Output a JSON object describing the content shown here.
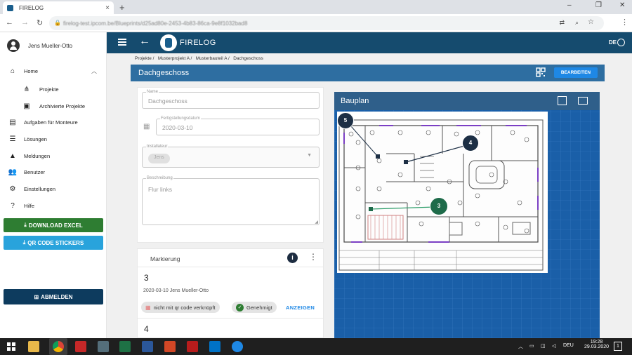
{
  "browser": {
    "tab_title": "FIRELOG",
    "tab_close": "×",
    "new_tab": "+",
    "url": "firelog-test.ipcom.be/Blueprints/d25ad80e-2453-4b83-86ca-9e8f1032bad8",
    "controls": {
      "minimize": "–",
      "maximize": "❐",
      "close": "✕"
    }
  },
  "app": {
    "brand": "FIRELOG",
    "language": "DE"
  },
  "sidebar": {
    "user_name": "Jens Mueller-Otto",
    "items": [
      {
        "label": "Home",
        "icon": "home-icon"
      },
      {
        "label": "Projekte",
        "icon": "hierarchy-icon"
      },
      {
        "label": "Archivierte Projekte",
        "icon": "archive-icon"
      },
      {
        "label": "Aufgaben für Monteure",
        "icon": "clipboard-icon"
      },
      {
        "label": "Lösungen",
        "icon": "list-icon"
      },
      {
        "label": "Meldungen",
        "icon": "warning-icon"
      },
      {
        "label": "Benutzer",
        "icon": "people-icon"
      },
      {
        "label": "Einstellungen",
        "icon": "gear-icon"
      },
      {
        "label": "Hilfe",
        "icon": "help-icon"
      }
    ],
    "download_excel": "DOWNLOAD EXCEL",
    "qr_stickers": "QR CODE STICKERS",
    "logout": "ABMELDEN",
    "colors": {
      "excel": "#2e7d32",
      "qr": "#29a3dc",
      "logout": "#0d3b5e"
    }
  },
  "breadcrumbs": [
    "Projekte /",
    "Musterprojekt A /",
    "Musterbauteil A /",
    "Dachgeschoss"
  ],
  "page_title": "Dachgeschoss",
  "edit_button": "BEARBEITEN",
  "form": {
    "name_label": "Name",
    "name_value": "Dachgeschoss",
    "date_label": "Fertigstellungsdatum",
    "date_value": "2020-03-10",
    "installer_label": "Installateur",
    "installer_chip": "Jens",
    "description_label": "Beschreibung",
    "description_value": "Flur links"
  },
  "marking": {
    "header": "Markierung",
    "number": "3",
    "meta": "2020-03-10 Jens Mueller-Otto",
    "chip_qr": "nicht mit qr code verknüpft",
    "chip_approved": "Genehmigt",
    "show_button": "ANZEIGEN",
    "next_number": "4"
  },
  "blueprint": {
    "title": "Bauplan",
    "markers": [
      {
        "label": "5",
        "color": "#1d2f45"
      },
      {
        "label": "4",
        "color": "#1d2f45"
      },
      {
        "label": "3",
        "color": "#1e6b4a"
      }
    ]
  },
  "taskbar": {
    "language": "DEU",
    "time": "19:28",
    "date": "29.03.2020",
    "notifications": "1"
  }
}
